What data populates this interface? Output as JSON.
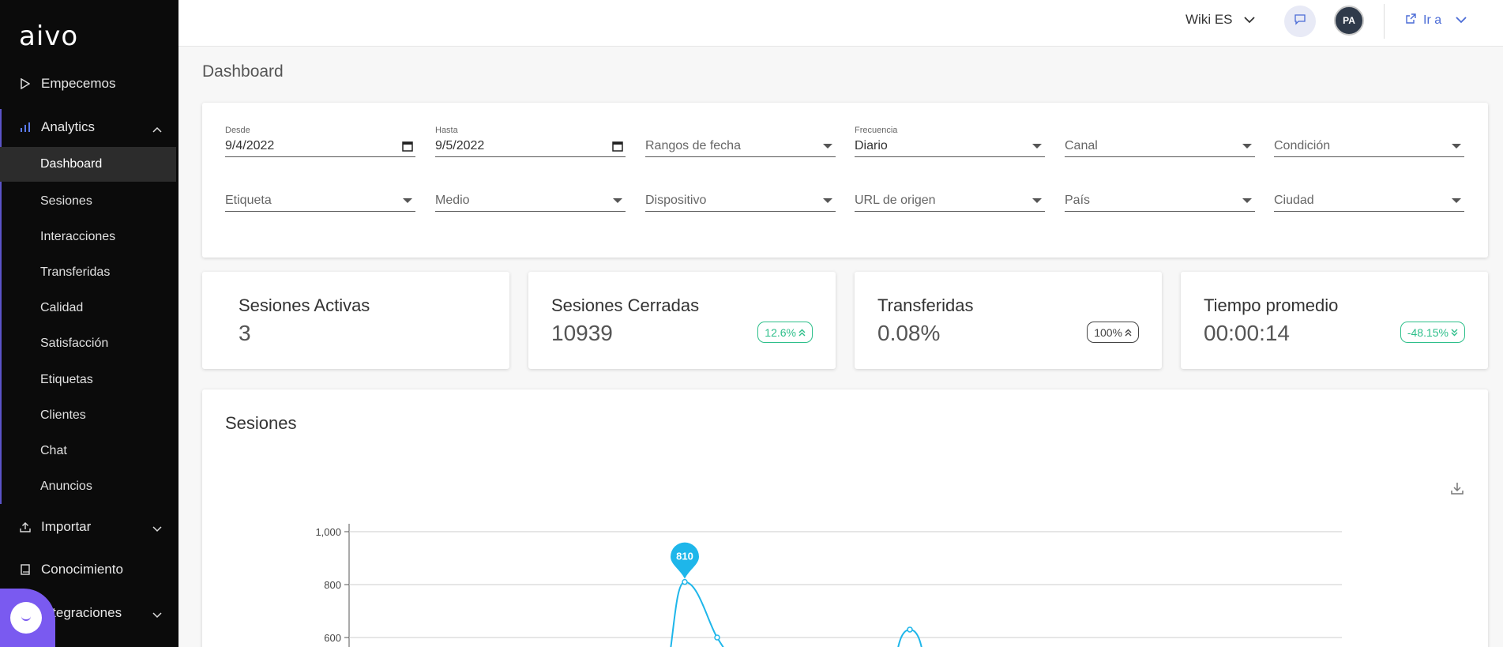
{
  "sidebar": {
    "logo": "aivo",
    "items": [
      {
        "label": "Empecemos",
        "icon": "play-icon"
      },
      {
        "label": "Analytics",
        "icon": "bar-chart-icon",
        "expanded": true
      },
      {
        "label": "Importar",
        "icon": "upload-icon"
      },
      {
        "label": "Conocimiento",
        "icon": "book-icon"
      },
      {
        "label": "Integraciones",
        "icon": "plug-icon"
      }
    ],
    "analytics_sub": [
      {
        "label": "Dashboard",
        "active": true
      },
      {
        "label": "Sesiones"
      },
      {
        "label": "Interacciones"
      },
      {
        "label": "Transferidas"
      },
      {
        "label": "Calidad"
      },
      {
        "label": "Satisfacción"
      },
      {
        "label": "Etiquetas"
      },
      {
        "label": "Clientes"
      },
      {
        "label": "Chat"
      },
      {
        "label": "Anuncios"
      }
    ]
  },
  "topbar": {
    "workspace": "Wiki ES",
    "avatar_initials": "PA",
    "goto_label": "Ir a"
  },
  "page": {
    "title": "Dashboard"
  },
  "filters": {
    "desde": {
      "label": "Desde",
      "value": "9/4/2022"
    },
    "hasta": {
      "label": "Hasta",
      "value": "9/5/2022"
    },
    "rangos": {
      "placeholder": "Rangos de fecha"
    },
    "frecuencia": {
      "label": "Frecuencia",
      "value": "Diario"
    },
    "canal": {
      "placeholder": "Canal"
    },
    "condicion": {
      "placeholder": "Condición"
    },
    "etiqueta": {
      "placeholder": "Etiqueta"
    },
    "medio": {
      "placeholder": "Medio"
    },
    "dispositivo": {
      "placeholder": "Dispositivo"
    },
    "url_origen": {
      "placeholder": "URL de origen"
    },
    "pais": {
      "placeholder": "País"
    },
    "ciudad": {
      "placeholder": "Ciudad"
    }
  },
  "kpis": [
    {
      "title": "Sesiones Activas",
      "value": "3"
    },
    {
      "title": "Sesiones Cerradas",
      "value": "10939",
      "badge": "12.6%",
      "trend": "up",
      "badge_color": "#2dbf8a"
    },
    {
      "title": "Transferidas",
      "value": "0.08%",
      "badge": "100%",
      "trend": "up",
      "badge_color": "#444444"
    },
    {
      "title": "Tiempo promedio",
      "value": "00:00:14",
      "badge": "-48.15%",
      "trend": "down",
      "badge_color": "#2dbf8a"
    }
  ],
  "chart": {
    "title": "Sesiones",
    "color": "#1eb6ea",
    "peak_label": "810"
  },
  "chart_data": {
    "type": "line",
    "title": "Sesiones",
    "yticks": [
      "1,000",
      "800",
      "600"
    ],
    "ylim": [
      0,
      1000
    ],
    "grid": true,
    "series": [
      {
        "values": [
          810,
          600,
          630
        ]
      }
    ],
    "annotations": [
      {
        "value": 810,
        "label": "810"
      }
    ]
  }
}
